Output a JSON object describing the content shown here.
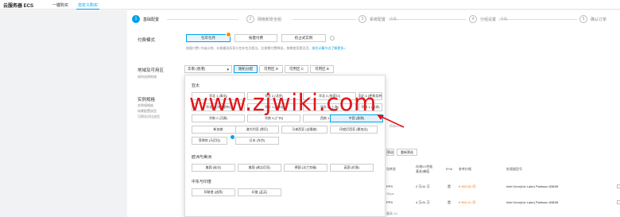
{
  "topbar": {
    "brand": "云服务器 ECS",
    "tabs": [
      {
        "label": "一键购买"
      },
      {
        "label": "自定义购买"
      }
    ]
  },
  "steps": [
    {
      "num": "1",
      "label": "基础配置",
      "sub": ""
    },
    {
      "num": "2",
      "label": "网络和安全组",
      "sub": ""
    },
    {
      "num": "3",
      "label": "系统配置",
      "sub": "(选填)"
    },
    {
      "num": "4",
      "label": "分组设置",
      "sub": "(选填)"
    },
    {
      "num": "5",
      "label": "确认订单",
      "sub": ""
    }
  ],
  "billing": {
    "label": "付费模式",
    "options": [
      "包年包月",
      "按量付费",
      "抢占式实例"
    ],
    "badge": "%",
    "hint": "按量付费+节省计划，价格最低折扣与包年包月相当，比按需付费降低，按需使用更灵活，",
    "hint_link": "前往计算节点了解更多>"
  },
  "region": {
    "label": "地域及可用区",
    "sub": "如何选择地域",
    "selected": "华南 (香港)",
    "zones": [
      "随机分配",
      "可用区 D",
      "可用区 C",
      "可用区 B"
    ]
  },
  "instance": {
    "label": "实例规格",
    "subs": [
      "实例规格族",
      "场景配置选型",
      "可视化对比选型"
    ]
  },
  "dropdown": {
    "groups": [
      {
        "title": "亚太",
        "rows": [
          [
            "华北 1 (青岛)",
            "华北 2 (北京)",
            "华北 3 (张家口)",
            "华北 5 (呼和浩特)"
          ],
          [
            "华北 6 (乌兰察布)",
            "华东 1 (杭州)",
            "华东 2 (上海)",
            "华南 1 (深圳)"
          ],
          [
            "华南 2 (河源)",
            "华南 3 (广州)",
            "西南 1 (成都)",
            "中国 (香港)"
          ],
          [
            "新加坡",
            "澳大利亚 (悉尼)",
            "马来西亚 (吉隆坡)",
            "印度尼西亚 (雅加达)"
          ],
          [
            "菲律宾 (马尼拉)",
            "日本 (东京)"
          ]
        ]
      },
      {
        "title": "欧洲与美洲",
        "rows": [
          [
            "美国 (硅谷)",
            "美国 (弗吉尼亚)",
            "德国 (法兰克福)",
            "英国 (伦敦)"
          ]
        ]
      },
      {
        "title": "中东与印度",
        "rows": [
          [
            "阿联酋 (迪拜)",
            "印度 (孟买)"
          ]
        ]
      }
    ],
    "selected_region": "中国 (香港)"
  },
  "watermark": "www.zjwiki.com",
  "partial_select": "所有vCPU",
  "table": {
    "actions": [
      "筛选",
      "重新筛选"
    ],
    "headers": [
      "包转发",
      "存储I/O性能\n基准/峰值",
      "IPv6",
      "参考价格",
      "处理器型号"
    ],
    "rows": [
      {
        "pps": "PPS",
        "io": "2 万/11 万",
        "ipv6": "是",
        "price": "¥ 452.06 /月",
        "cpu": "Intel Xeon(Ice Lake) Platinum 8369B"
      },
      {
        "pps": "PPS",
        "io": "4 万/11 万",
        "ipv6": "是",
        "price": "¥ 904.11 /月",
        "cpu": "Intel Xeon(Ice Lake) Platinum 8369B"
      }
    ],
    "partial": [
      "Gbps",
      "最高 10"
    ]
  },
  "colors": {
    "accent": "#00a0e9",
    "badge": "#ff8a00",
    "price": "#ff6a00",
    "watermark": "#e0161b"
  }
}
